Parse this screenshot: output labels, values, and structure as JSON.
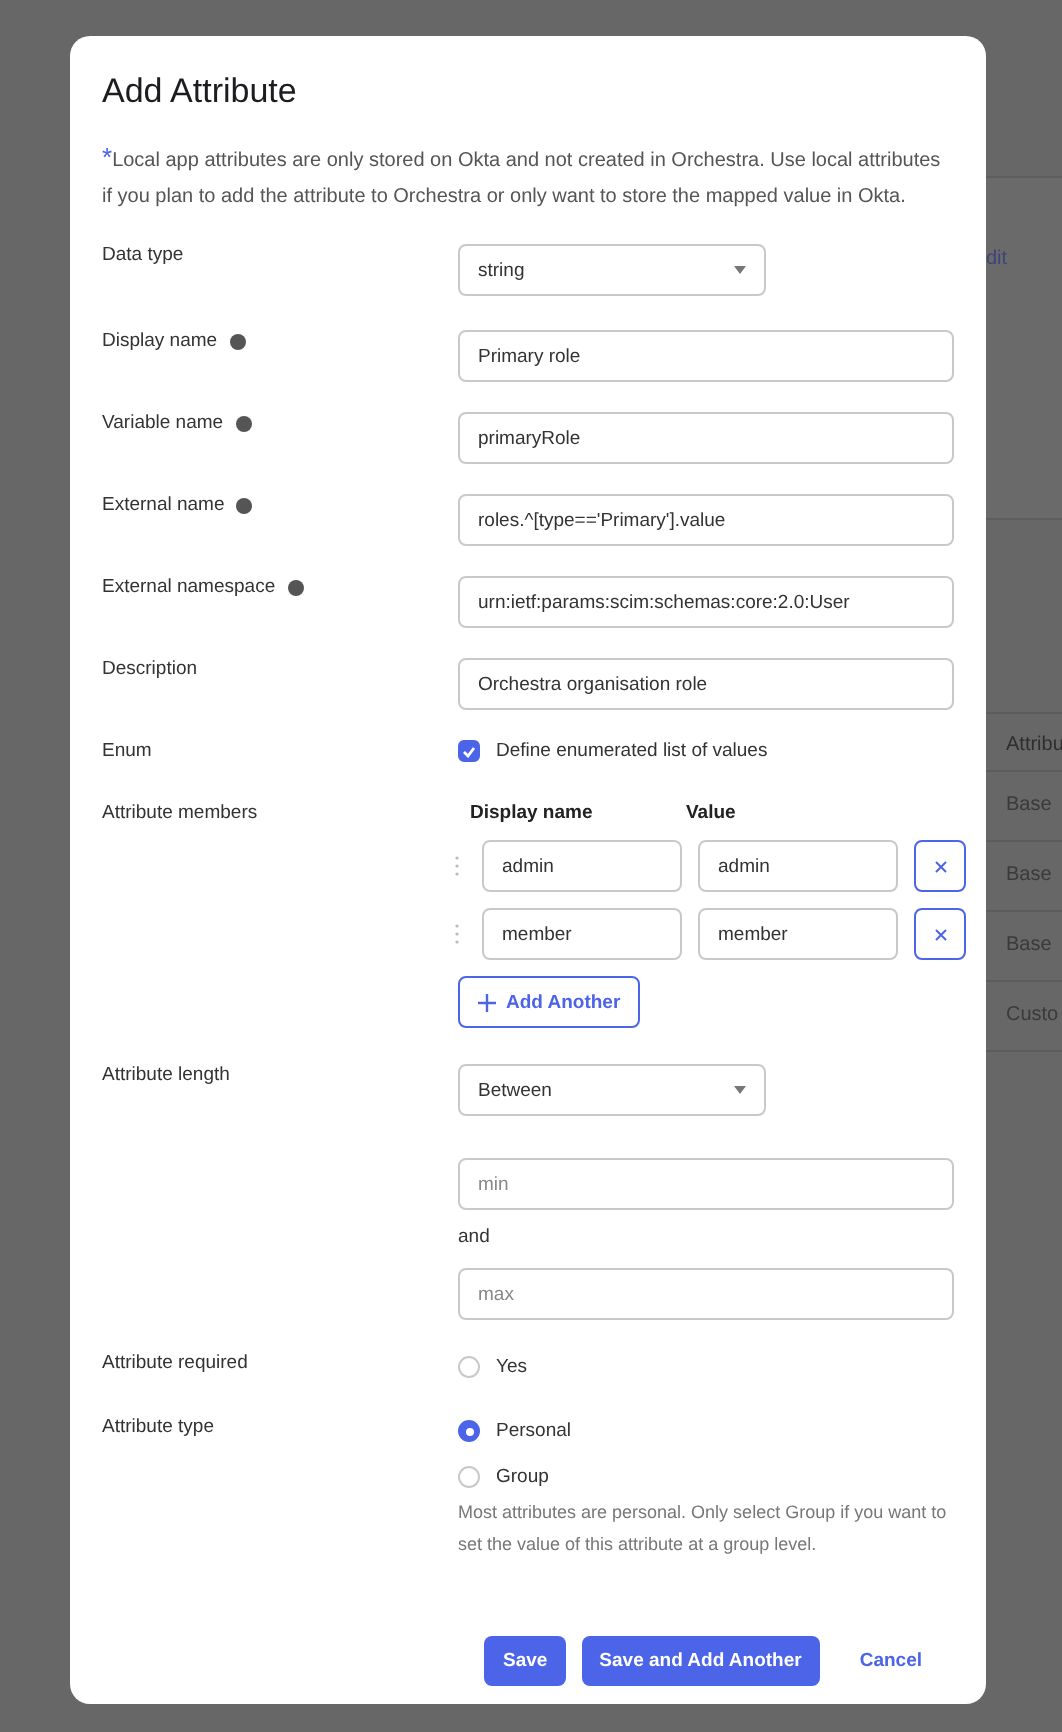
{
  "background": {
    "link": "dit",
    "table_header": "Attribu",
    "table_rows": [
      "Base",
      "Base",
      "Base",
      "Custo"
    ]
  },
  "dialog": {
    "title": "Add Attribute",
    "note_mark": "*",
    "note": "Local app attributes are only stored on Okta and not created in Orchestra. Use local attributes if you plan to add the attribute to Orchestra or only want to store the mapped value in Okta.",
    "fields": [
      {
        "kind": "select",
        "label": "Data type",
        "help": false,
        "value": "string"
      },
      {
        "kind": "text",
        "label": "Display name",
        "help": true,
        "value": "Primary role"
      },
      {
        "kind": "text",
        "label": "Variable name",
        "help": true,
        "value": "primaryRole"
      },
      {
        "kind": "text",
        "label": "External name",
        "help": true,
        "value": "roles.^[type=='Primary'].value"
      },
      {
        "kind": "text",
        "label": "External namespace",
        "help": true,
        "value": "urn:ietf:params:scim:schemas:core:2.0:User"
      },
      {
        "kind": "text",
        "label": "Description",
        "help": false,
        "value": "Orchestra organisation role"
      },
      {
        "kind": "checkbox",
        "label": "Enum",
        "help": false,
        "option": "Define enumerated list of values",
        "checked": true
      },
      {
        "kind": "members",
        "label": "Attribute members",
        "help": false,
        "columns": [
          "Display name",
          "Value"
        ],
        "rows": [
          {
            "name": "admin",
            "value": "admin"
          },
          {
            "name": "member",
            "value": "member"
          }
        ],
        "add_label": "Add Another"
      },
      {
        "kind": "length",
        "label": "Attribute length",
        "help": false,
        "value": "Between",
        "min_placeholder": "min",
        "joiner": "and",
        "max_placeholder": "max"
      },
      {
        "kind": "checkbox_radio",
        "label": "Attribute required",
        "help": false,
        "option": "Yes",
        "checked": false
      },
      {
        "kind": "radio",
        "label": "Attribute type",
        "help": false,
        "options": [
          {
            "label": "Personal",
            "selected": true
          },
          {
            "label": "Group",
            "selected": false
          }
        ],
        "hint": "Most attributes are personal. Only select Group if you want to set the value of this attribute at a group level."
      }
    ],
    "buttons": [
      {
        "kind": "primary",
        "label": "Save"
      },
      {
        "kind": "primary",
        "label": "Save and Add Another"
      },
      {
        "kind": "link",
        "label": "Cancel"
      }
    ]
  }
}
